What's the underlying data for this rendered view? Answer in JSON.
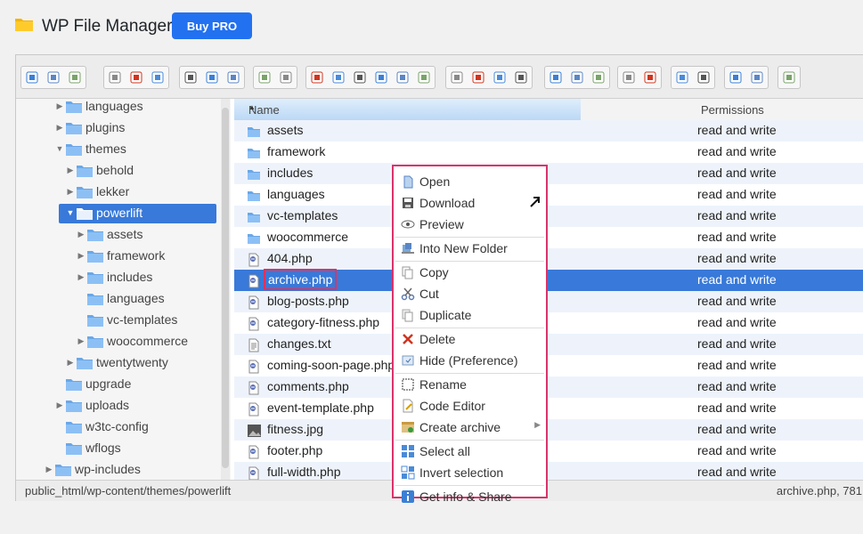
{
  "header": {
    "title": "WP File Manager",
    "buy_label": "Buy PRO"
  },
  "toolbar_icons": [
    "back-icon",
    "forward-icon",
    "up-icon",
    "home-icon",
    "new-file-icon",
    "save-icon",
    "open-icon",
    "save-icon",
    "select-icon",
    "undo-icon",
    "redo-icon",
    "copy-icon",
    "cut-icon",
    "paste-icon",
    "delete-icon",
    "empty-icon",
    "hide-icon",
    "duplicate-icon",
    "rename-icon",
    "edit-icon",
    "resize-icon",
    "view-icons-icon",
    "view-list-icon",
    "view-small-icon",
    "preview-icon",
    "info-icon",
    "archive-icon",
    "extract-icon",
    "sort-icon",
    "help-icon",
    "fullscreen-icon"
  ],
  "tree": [
    {
      "label": "languages",
      "depth": 1,
      "arrow": "closed",
      "selected": false
    },
    {
      "label": "plugins",
      "depth": 1,
      "arrow": "closed",
      "selected": false
    },
    {
      "label": "themes",
      "depth": 1,
      "arrow": "open",
      "selected": false
    },
    {
      "label": "behold",
      "depth": 2,
      "arrow": "closed",
      "selected": false
    },
    {
      "label": "lekker",
      "depth": 2,
      "arrow": "closed",
      "selected": false
    },
    {
      "label": "powerlift",
      "depth": 2,
      "arrow": "open",
      "selected": true
    },
    {
      "label": "assets",
      "depth": 3,
      "arrow": "closed",
      "selected": false
    },
    {
      "label": "framework",
      "depth": 3,
      "arrow": "closed",
      "selected": false
    },
    {
      "label": "includes",
      "depth": 3,
      "arrow": "closed",
      "selected": false
    },
    {
      "label": "languages",
      "depth": 3,
      "arrow": "none",
      "selected": false
    },
    {
      "label": "vc-templates",
      "depth": 3,
      "arrow": "none",
      "selected": false
    },
    {
      "label": "woocommerce",
      "depth": 3,
      "arrow": "closed",
      "selected": false
    },
    {
      "label": "twentytwenty",
      "depth": 2,
      "arrow": "closed",
      "selected": false
    },
    {
      "label": "upgrade",
      "depth": 1,
      "arrow": "none",
      "selected": false
    },
    {
      "label": "uploads",
      "depth": 1,
      "arrow": "closed",
      "selected": false
    },
    {
      "label": "w3tc-config",
      "depth": 1,
      "arrow": "none",
      "selected": false
    },
    {
      "label": "wflogs",
      "depth": 1,
      "arrow": "none",
      "selected": false
    },
    {
      "label": "wp-includes",
      "depth": 0,
      "arrow": "closed",
      "selected": false
    }
  ],
  "list": {
    "col_name": "Name",
    "col_perm": "Permissions",
    "files": [
      {
        "name": "assets",
        "type": "folder",
        "perm": "read and write",
        "selected": false
      },
      {
        "name": "framework",
        "type": "folder",
        "perm": "read and write",
        "selected": false
      },
      {
        "name": "includes",
        "type": "folder",
        "perm": "read and write",
        "selected": false
      },
      {
        "name": "languages",
        "type": "folder",
        "perm": "read and write",
        "selected": false
      },
      {
        "name": "vc-templates",
        "type": "folder",
        "perm": "read and write",
        "selected": false
      },
      {
        "name": "woocommerce",
        "type": "folder",
        "perm": "read and write",
        "selected": false
      },
      {
        "name": "404.php",
        "type": "php",
        "perm": "read and write",
        "selected": false
      },
      {
        "name": "archive.php",
        "type": "php",
        "perm": "read and write",
        "selected": true
      },
      {
        "name": "blog-posts.php",
        "type": "php",
        "perm": "read and write",
        "selected": false
      },
      {
        "name": "category-fitness.php",
        "type": "php",
        "perm": "read and write",
        "selected": false
      },
      {
        "name": "changes.txt",
        "type": "txt",
        "perm": "read and write",
        "selected": false
      },
      {
        "name": "coming-soon-page.php",
        "type": "php",
        "perm": "read and write",
        "selected": false
      },
      {
        "name": "comments.php",
        "type": "php",
        "perm": "read and write",
        "selected": false
      },
      {
        "name": "event-template.php",
        "type": "php",
        "perm": "read and write",
        "selected": false
      },
      {
        "name": "fitness.jpg",
        "type": "image",
        "perm": "read and write",
        "selected": false
      },
      {
        "name": "footer.php",
        "type": "php",
        "perm": "read and write",
        "selected": false
      },
      {
        "name": "full-width.php",
        "type": "php",
        "perm": "read and write",
        "selected": false
      }
    ]
  },
  "status": {
    "path": "public_html/wp-content/themes/powerlift",
    "info": "archive.php, 781"
  },
  "context_menu": {
    "groups": [
      [
        {
          "label": "Open",
          "icon": "open-icon"
        },
        {
          "label": "Download",
          "icon": "download-icon"
        },
        {
          "label": "Preview",
          "icon": "preview-icon"
        }
      ],
      [
        {
          "label": "Into New Folder",
          "icon": "new-folder-icon"
        }
      ],
      [
        {
          "label": "Copy",
          "icon": "copy-icon"
        },
        {
          "label": "Cut",
          "icon": "cut-icon"
        },
        {
          "label": "Duplicate",
          "icon": "duplicate-icon"
        }
      ],
      [
        {
          "label": "Delete",
          "icon": "delete-icon"
        },
        {
          "label": "Hide (Preference)",
          "icon": "hide-icon"
        }
      ],
      [
        {
          "label": "Rename",
          "icon": "rename-icon"
        },
        {
          "label": "Code Editor",
          "icon": "code-editor-icon"
        },
        {
          "label": "Create archive",
          "icon": "archive-icon",
          "submenu": true
        }
      ],
      [
        {
          "label": "Select all",
          "icon": "select-all-icon"
        },
        {
          "label": "Invert selection",
          "icon": "invert-selection-icon"
        }
      ],
      [
        {
          "label": "Get info & Share",
          "icon": "info-icon"
        }
      ]
    ]
  },
  "colors": {
    "accent": "#2271f0",
    "selection": "#3879d9",
    "highlight": "#d9336a"
  }
}
